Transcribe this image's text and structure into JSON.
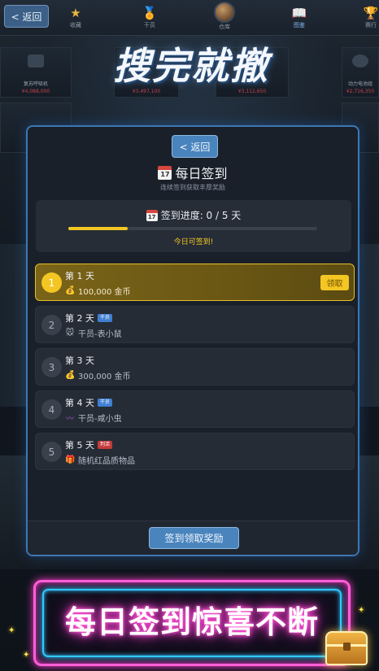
{
  "background": {
    "back_label": "< 返回",
    "nav": [
      {
        "label": "收藏",
        "icon": "star-icon",
        "glyph": "★"
      },
      {
        "label": "干员",
        "icon": "medal-icon",
        "glyph": "🏅"
      },
      {
        "label": "仓库",
        "icon": "storage-box-icon",
        "glyph": ""
      },
      {
        "label": "图鉴",
        "icon": "book-icon",
        "glyph": "📖"
      },
      {
        "label": "赛行",
        "icon": "trophy-icon",
        "glyph": "🏆"
      }
    ],
    "game_title": "搜完就撤",
    "tiles": [
      {
        "name": "复苏呼吸机",
        "price": "¥4,088,000"
      },
      {
        "name": "",
        "price": "¥3,497,100"
      },
      {
        "name": "",
        "price": "¥3,112,650"
      },
      {
        "name": "",
        "price": ""
      },
      {
        "name": "动力电池组",
        "price": "¥2,716,350"
      }
    ]
  },
  "modal": {
    "back_label": "< 返回",
    "title": "每日签到",
    "calendar_icon_text": "17",
    "subtitle": "连续签到获取丰厚奖励",
    "progress": {
      "label": "签到进度: 0 / 5 天",
      "fraction": 0.24,
      "today_text": "今日可签到!"
    },
    "days": [
      {
        "num": "1",
        "title": "第 1 天",
        "tag": "",
        "tag_color": "",
        "reward_icon": "money-bag-icon",
        "reward_glyph": "💰",
        "reward": "100,000 金币",
        "active": true,
        "claim_label": "领取"
      },
      {
        "num": "2",
        "title": "第 2 天",
        "tag": "干员",
        "tag_color": "blue",
        "reward_icon": "mouse-icon",
        "reward_glyph": "🐭",
        "reward": "干员-表小鼠",
        "active": false
      },
      {
        "num": "3",
        "title": "第 3 天",
        "tag": "",
        "tag_color": "",
        "reward_icon": "money-bag-icon",
        "reward_glyph": "💰",
        "reward": "300,000 金币",
        "active": false
      },
      {
        "num": "4",
        "title": "第 4 天",
        "tag": "干员",
        "tag_color": "blue",
        "reward_icon": "worm-icon",
        "reward_glyph": "〰",
        "reward": "干员-咸小虫",
        "active": false
      },
      {
        "num": "5",
        "title": "第 5 天",
        "tag": "判活",
        "tag_color": "red",
        "reward_icon": "gift-icon",
        "reward_glyph": "🎁",
        "reward": "随机红品质物品",
        "active": false
      }
    ],
    "footer_button": "签到领取奖励"
  },
  "banner": {
    "text": "每日签到惊喜不断"
  },
  "colors": {
    "accent_yellow": "#f3c623",
    "button_blue": "#4a84bd",
    "neon_pink": "#ff5ed9",
    "neon_cyan": "#31c8ff"
  }
}
